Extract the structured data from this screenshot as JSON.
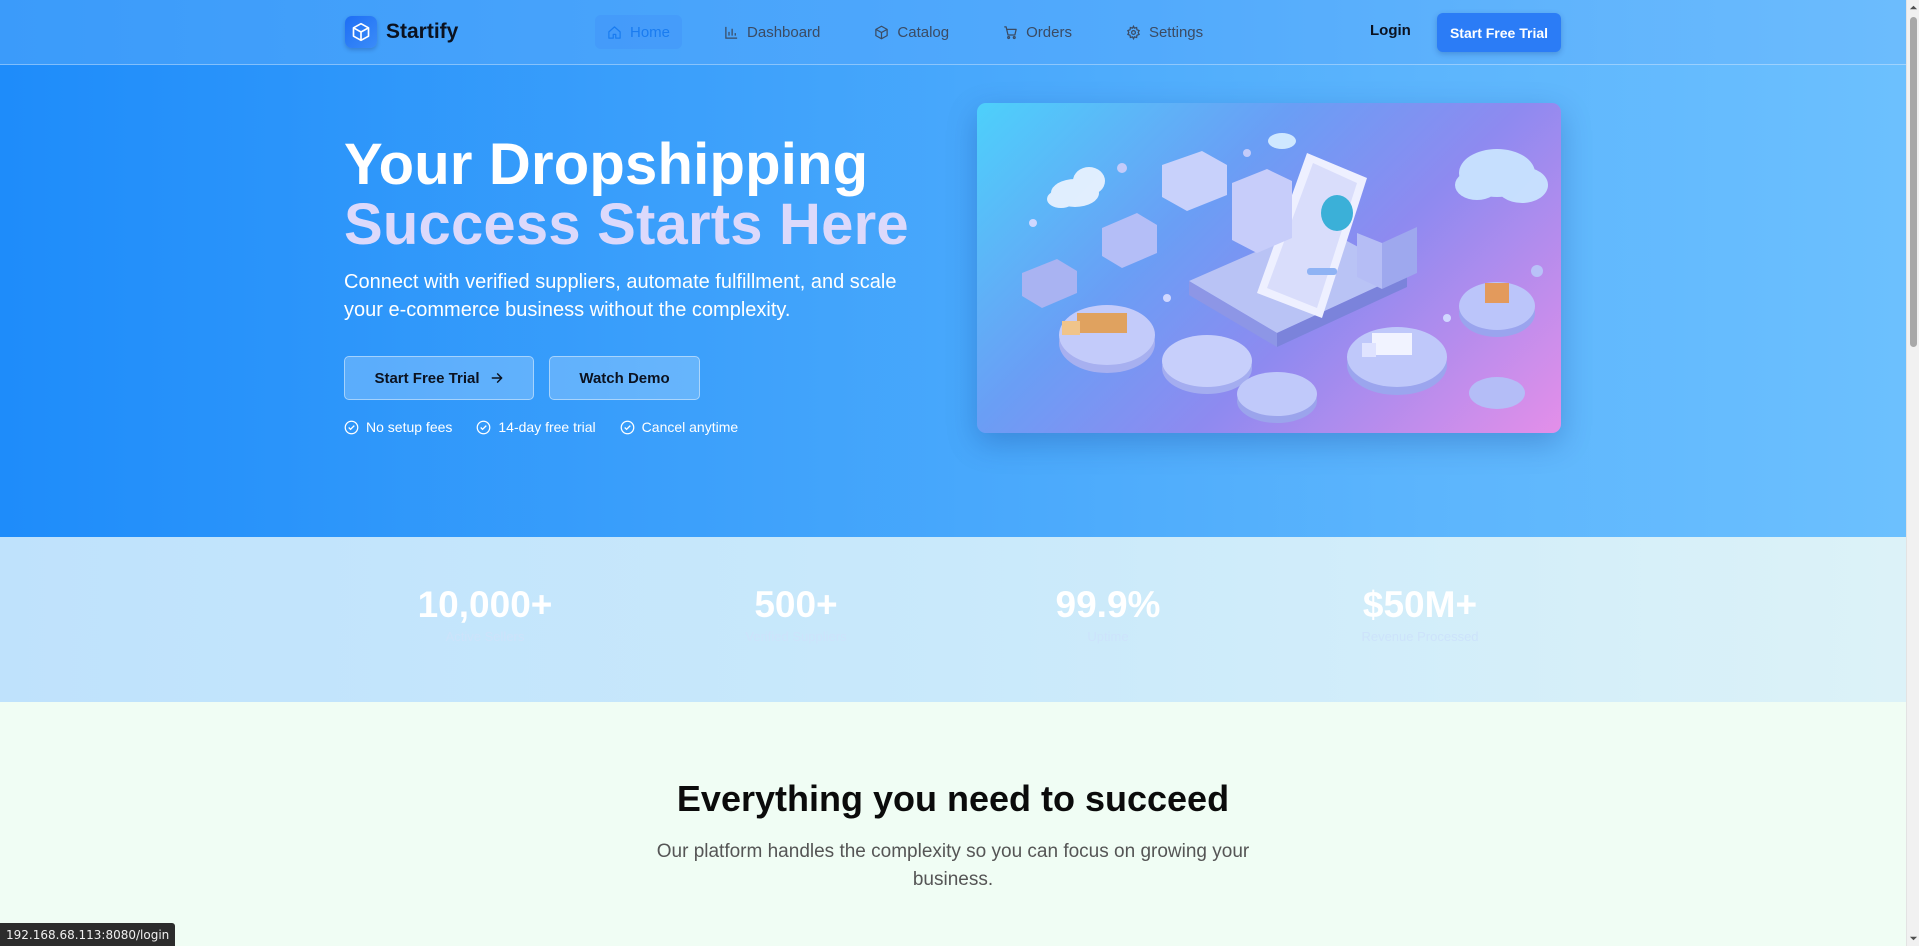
{
  "brand": {
    "name": "Startify",
    "accent": "#2b7cf6"
  },
  "nav": {
    "items": [
      {
        "label": "Home",
        "icon": "home-icon",
        "active": true
      },
      {
        "label": "Dashboard",
        "icon": "bar-chart-icon",
        "active": false
      },
      {
        "label": "Catalog",
        "icon": "box-icon",
        "active": false
      },
      {
        "label": "Orders",
        "icon": "cart-icon",
        "active": false
      },
      {
        "label": "Settings",
        "icon": "gear-icon",
        "active": false
      }
    ],
    "login_label": "Login",
    "cta_label": "Start Free Trial"
  },
  "hero": {
    "title_line1": "Your Dropshipping",
    "title_line2": "Success Starts Here",
    "subtitle": "Connect with verified suppliers, automate fulfillment, and scale your e-commerce business without the complexity.",
    "primary_button": "Start Free Trial",
    "secondary_button": "Watch Demo",
    "checks": [
      "No setup fees",
      "14-day free trial",
      "Cancel anytime"
    ]
  },
  "stats": [
    {
      "value": "10,000+",
      "label": "Active Sellers"
    },
    {
      "value": "500+",
      "label": "Verified Suppliers"
    },
    {
      "value": "99.9%",
      "label": "Uptime"
    },
    {
      "value": "$50M+",
      "label": "Revenue Processed"
    }
  ],
  "features": {
    "title": "Everything you need to succeed",
    "subtitle": "Our platform handles the complexity so you can focus on growing your business."
  },
  "status_url": "192.168.68.113:8080/login"
}
